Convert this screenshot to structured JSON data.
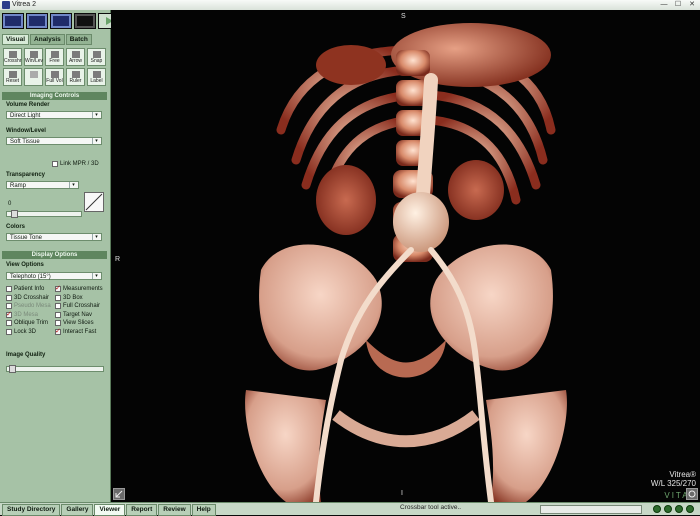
{
  "window": {
    "title": "Vitrea 2",
    "controls": [
      "—",
      "☐",
      "✕"
    ]
  },
  "top_buttons": [
    "layout-1x1",
    "layout-2x2",
    "layout-1x3",
    "black-screen",
    "play"
  ],
  "tabs": [
    "Visual",
    "Analysis",
    "Batch"
  ],
  "tools": [
    {
      "name": "crosshair",
      "label": "Crosshr"
    },
    {
      "name": "window-level",
      "label": "Win/Lev"
    },
    {
      "name": "free",
      "label": "Free"
    },
    {
      "name": "arrow",
      "label": "Arrow"
    },
    {
      "name": "snap",
      "label": "Snap"
    },
    {
      "name": "reset",
      "label": "Reset"
    },
    {
      "name": "disabled",
      "label": ""
    },
    {
      "name": "full-vol",
      "label": "Full Vol"
    },
    {
      "name": "ruler",
      "label": "Ruler"
    },
    {
      "name": "label",
      "label": "Label"
    }
  ],
  "imaging_controls": {
    "header": "Imaging Controls",
    "volume_render_label": "Volume Render",
    "volume_render_value": "Direct Light",
    "window_level_label": "Window/Level",
    "window_level_value": "Soft Tissue",
    "link_label": "Link MPR / 3D",
    "transparency_label": "Transparency",
    "transparency_value": "Ramp",
    "transparency_number": "0",
    "transparency_level": 0.05,
    "colors_label": "Colors",
    "colors_value": "Tissue Tone"
  },
  "display_options": {
    "header": "Display Options",
    "view_options_label": "View Options",
    "view_options_value": "Telephoto (15°)",
    "checkboxes": [
      {
        "label": "Patient Info",
        "checked": false
      },
      {
        "label": "Measurements",
        "checked": true
      },
      {
        "label": "3D Crosshair",
        "checked": false
      },
      {
        "label": "3D Box",
        "checked": false
      },
      {
        "label": "Pseudo Mesa",
        "checked": false
      },
      {
        "label": "Full Crosshair",
        "checked": false
      },
      {
        "label": "3D Mesa",
        "checked": true
      },
      {
        "label": "Target Nav",
        "checked": false
      },
      {
        "label": "Oblique Trim",
        "checked": false
      },
      {
        "label": "View Slices",
        "checked": false
      },
      {
        "label": "Lock 3D",
        "checked": false
      },
      {
        "label": "Interact Fast",
        "checked": true
      }
    ],
    "image_quality_label": "Image Quality",
    "image_quality_level": 0.02
  },
  "viewer": {
    "top_label": "S",
    "bottom_label": "I",
    "left_label": "R",
    "watermark_line1": "Vitrea®",
    "watermark_line2": "W/L 325/270",
    "brand": "VITAL"
  },
  "bottom_tabs": [
    "Study Directory",
    "Gallery",
    "Viewer",
    "Report",
    "Review",
    "Help"
  ],
  "status": "Crossbar tool active.."
}
